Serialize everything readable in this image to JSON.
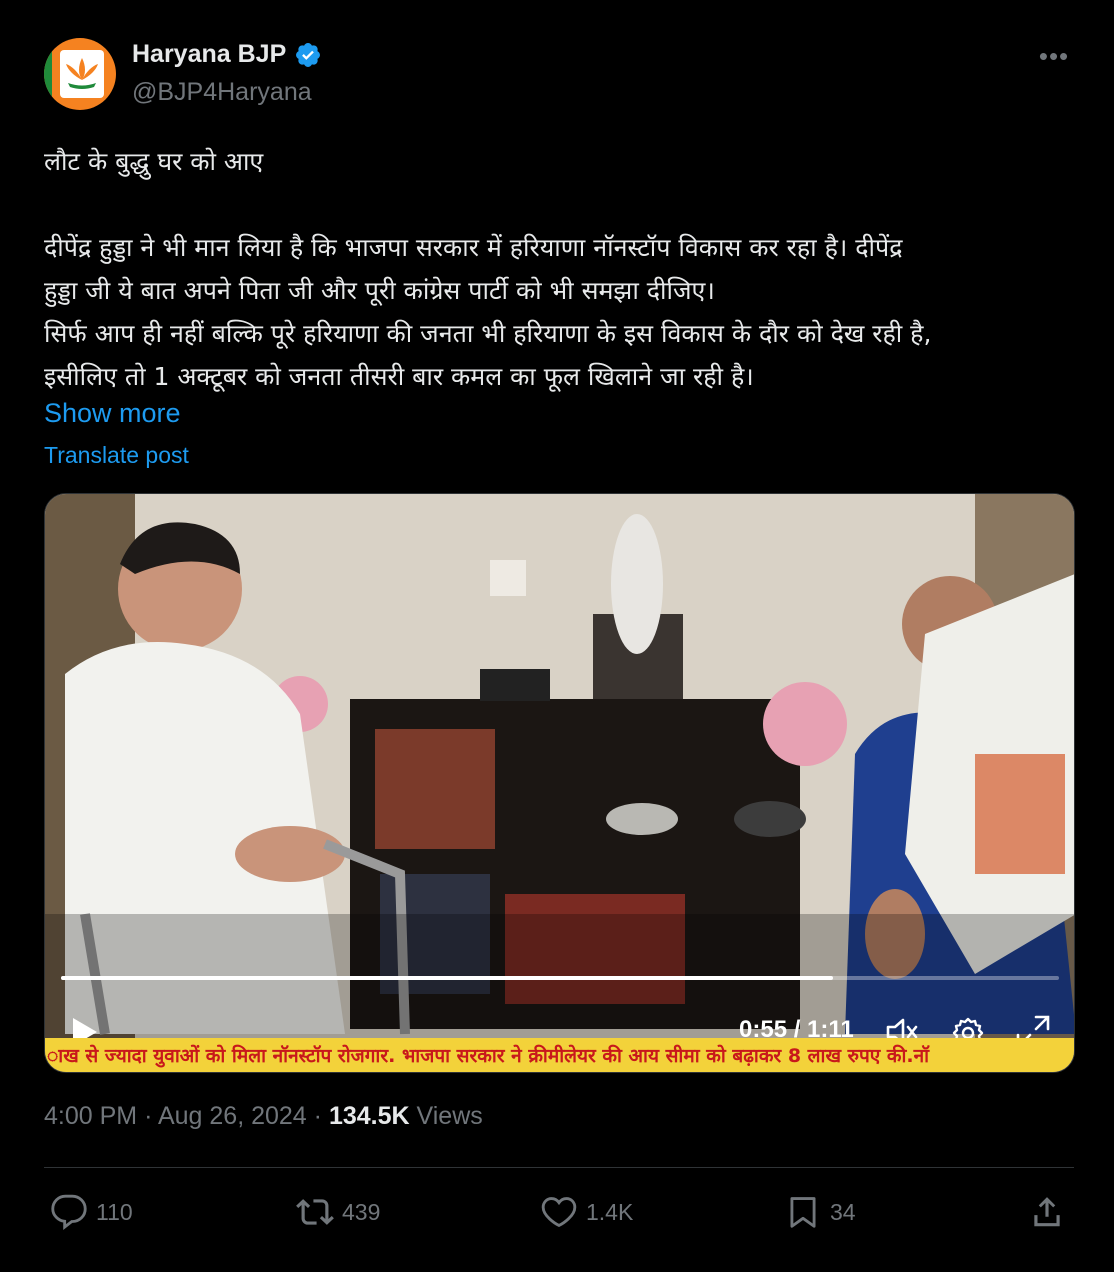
{
  "account": {
    "name": "Haryana BJP",
    "handle": "@BJP4Haryana",
    "verified": true,
    "verified_color": "#1d9bf0"
  },
  "post": {
    "lines": [
      "लौट के बुद्धु घर को आए",
      "",
      "दीपेंद्र हुड्डा ने भी मान लिया है कि भाजपा सरकार में हरियाणा नॉनस्टॉप विकास कर रहा है। दीपेंद्र",
      "हुड्डा जी ये बात अपने पिता जी और पूरी कांग्रेस पार्टी को भी समझा दीजिए।",
      "सिर्फ आप ही नहीं बल्कि पूरे हरियाणा की जनता भी हरियाणा के इस विकास के दौर को देख रही है,",
      "इसीलिए तो 1 अक्टूबर को जनता तीसरी बार कमल का फूल खिलाने जा रही है।"
    ],
    "show_more": "Show more",
    "translate": "Translate post"
  },
  "video": {
    "ticker": "ाख से ज्यादा युवाओं को मिला नॉनस्टॉप रोजगार.   भाजपा सरकार ने क्रीमीलेयर की आय सीमा को बढ़ाकर 8 लाख रुपए की.नॉ",
    "time": "0:55 / 1:11",
    "progress": 0.774
  },
  "meta": {
    "time": "4:00 PM",
    "date": "Aug 26, 2024",
    "views_count": "134.5K",
    "views_label": "Views"
  },
  "actions": {
    "replies": "110",
    "reposts": "439",
    "likes": "1.4K",
    "bookmarks": "34"
  },
  "colors": {
    "background": "#000000",
    "link": "#1d9bf0",
    "muted": "#71767b",
    "text": "#e7e9ea"
  }
}
